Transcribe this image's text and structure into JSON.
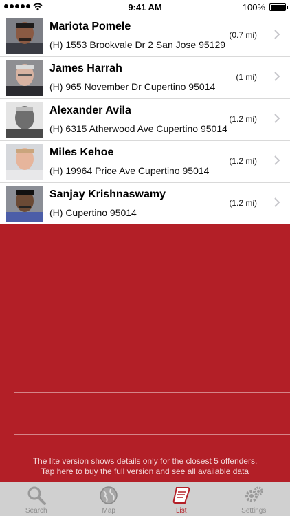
{
  "status_bar": {
    "time": "9:41 AM",
    "battery": "100%"
  },
  "offenders": [
    {
      "name": "Mariota Pomele",
      "address": "(H) 1553 Brookvale Dr 2 San Jose 95129",
      "distance": "(0.7 mi)"
    },
    {
      "name": "James Harrah",
      "address": "(H) 965 November Dr Cupertino 95014",
      "distance": "(1 mi)"
    },
    {
      "name": "Alexander Avila",
      "address": "(H) 6315 Atherwood Ave Cupertino 95014",
      "distance": "(1.2 mi)"
    },
    {
      "name": "Miles Kehoe",
      "address": "(H) 19964 Price Ave Cupertino 95014",
      "distance": "(1.2 mi)"
    },
    {
      "name": "Sanjay Krishnaswamy",
      "address": "(H)  Cupertino 95014",
      "distance": "(1.2 mi)"
    }
  ],
  "lite_message": {
    "line1": "The lite version shows details only for the closest 5 offenders.",
    "line2": "Tap here to buy the full version and see all available data"
  },
  "tabs": [
    {
      "label": "Search",
      "icon": "magnifier-icon",
      "active": false
    },
    {
      "label": "Map",
      "icon": "globe-icon",
      "active": false
    },
    {
      "label": "List",
      "icon": "scroll-icon",
      "active": true
    },
    {
      "label": "Settings",
      "icon": "gears-icon",
      "active": false
    }
  ],
  "colors": {
    "accent": "#b31f27",
    "tab_bar": "#d0d0d0",
    "inactive": "#8e8e8e"
  }
}
